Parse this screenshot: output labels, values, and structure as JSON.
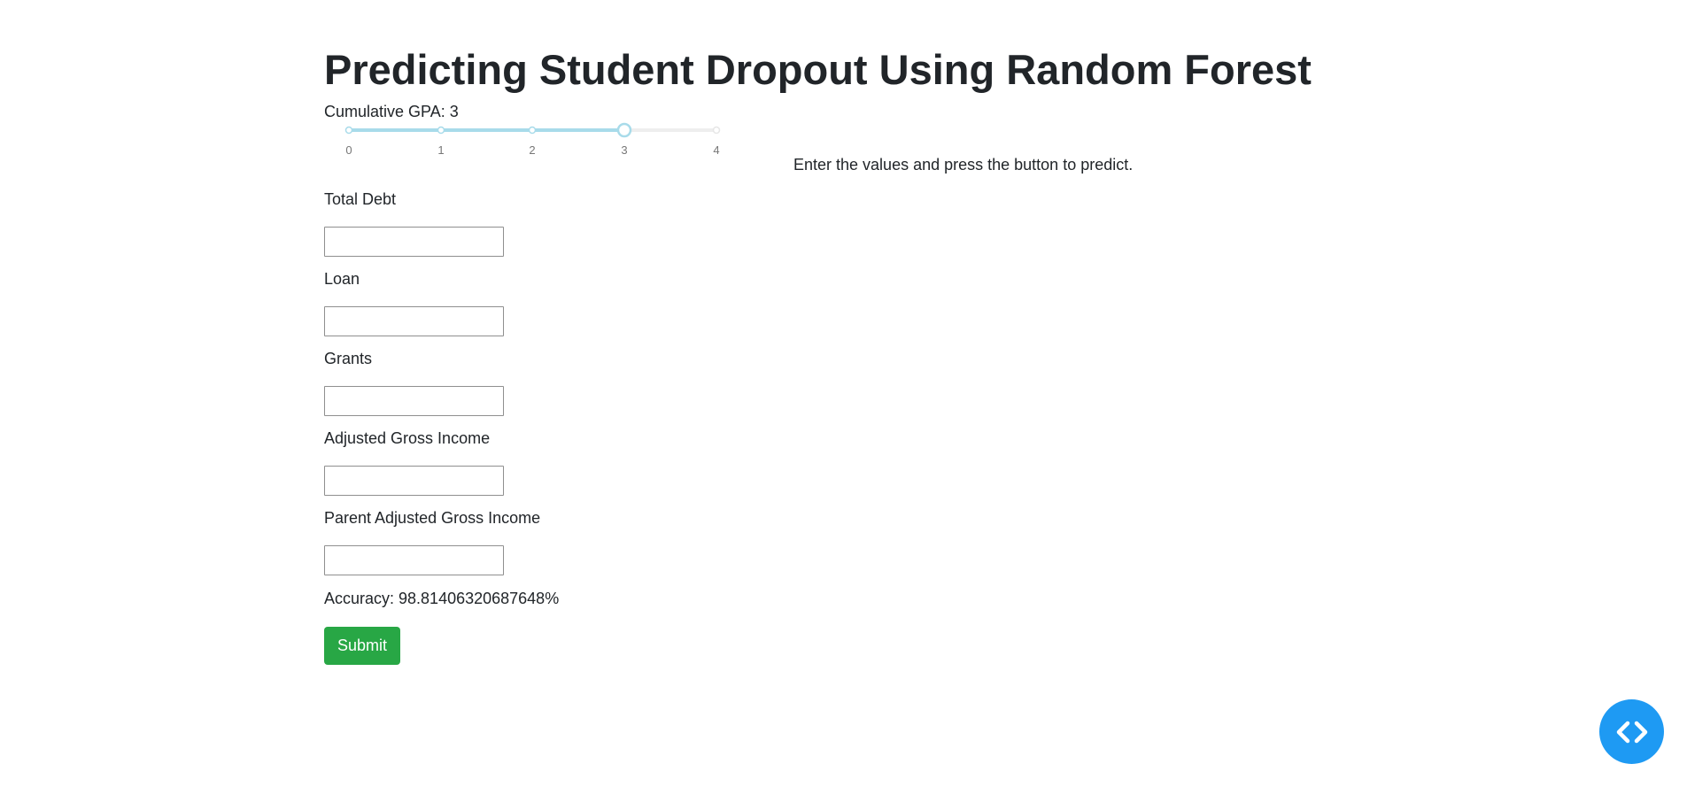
{
  "page": {
    "title": "Predicting Student Dropout Using Random Forest"
  },
  "gpa_slider": {
    "label": "Cumulative GPA: 3",
    "min": 0,
    "max": 4,
    "value": 3,
    "ticks": [
      "0",
      "1",
      "2",
      "3",
      "4"
    ],
    "track_color": "#eeeeee",
    "fill_color": "#a8dbea",
    "handle_color": "#a8dbea"
  },
  "fields": [
    {
      "label": "Total Debt",
      "value": "",
      "placeholder": ""
    },
    {
      "label": "Loan",
      "value": "",
      "placeholder": ""
    },
    {
      "label": "Grants",
      "value": "",
      "placeholder": ""
    },
    {
      "label": "Adjusted Gross Income",
      "value": "",
      "placeholder": ""
    },
    {
      "label": "Parent Adjusted Gross Income",
      "value": "",
      "placeholder": ""
    }
  ],
  "accuracy": "Accuracy: 98.81406320687648%",
  "submit": {
    "label": "Submit",
    "color": "#28a745"
  },
  "output": {
    "message": "Enter the values and press the button to predict."
  },
  "fab": {
    "icon": "code-chevrons-icon",
    "color": "#1e9af3"
  }
}
